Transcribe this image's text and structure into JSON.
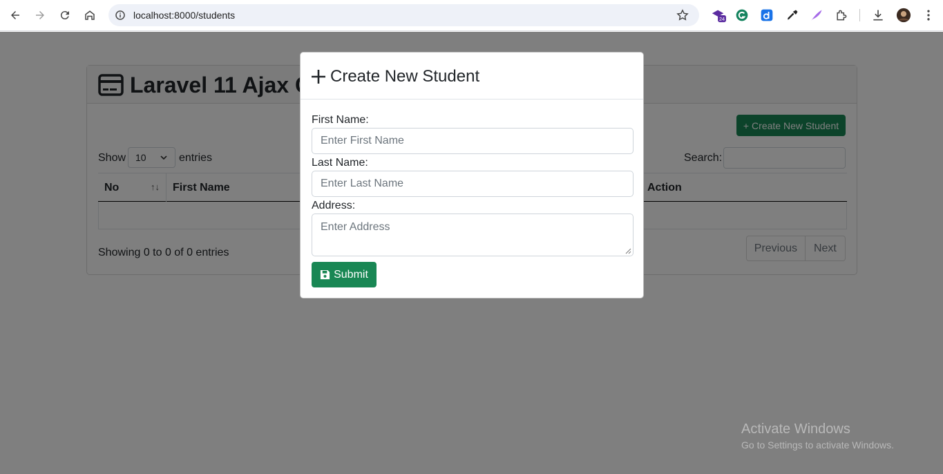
{
  "browser": {
    "url": "localhost:8000/students",
    "extension_badge": "24",
    "icons": [
      "back-icon",
      "forward-icon",
      "reload-icon",
      "home-icon",
      "site-info-icon",
      "bookmark-star-icon",
      "extension-24-icon",
      "grammarly-icon",
      "dictionary-extension-icon",
      "eyedropper-icon",
      "feather-icon",
      "extensions-puzzle-icon",
      "download-icon",
      "profile-avatar",
      "menu-icon"
    ]
  },
  "page": {
    "title": "Laravel 11 Ajax CRUD",
    "create_button": "Create New Student",
    "show_label": "Show",
    "page_length": "10",
    "entries_label": "entries",
    "search_label": "Search:",
    "columns": [
      "No",
      "First Name",
      "Action"
    ],
    "info": "Showing 0 to 0 of 0 entries",
    "prev": "Previous",
    "next": "Next"
  },
  "modal": {
    "title": "Create New Student",
    "first_name_label": "First Name:",
    "first_name_placeholder": "Enter First Name",
    "last_name_label": "Last Name:",
    "last_name_placeholder": "Enter Last Name",
    "address_label": "Address:",
    "address_placeholder": "Enter Address",
    "submit": "Submit"
  },
  "watermark": {
    "title": "Activate Windows",
    "subtitle": "Go to Settings to activate Windows."
  },
  "colors": {
    "accent": "#198754",
    "backdrop": "rgba(0,0,0,0.5)"
  }
}
